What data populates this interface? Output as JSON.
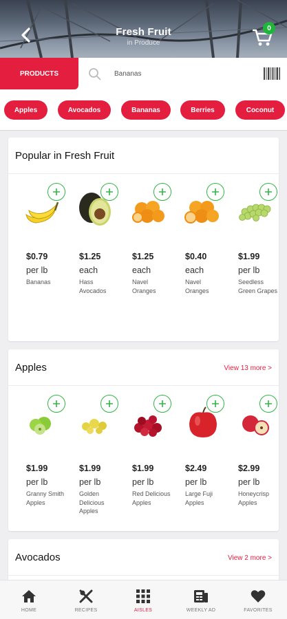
{
  "header": {
    "title": "Fresh Fruit",
    "subtitle": "in Produce",
    "cart_count": "0"
  },
  "search": {
    "products_label": "PRODUCTS",
    "placeholder": "Bananas"
  },
  "chips": [
    "Apples",
    "Avocados",
    "Bananas",
    "Berries",
    "Coconut"
  ],
  "sections": {
    "popular": {
      "title": "Popular in Fresh Fruit",
      "items": [
        {
          "price": "$0.79",
          "unit": "per lb",
          "name": "Bananas",
          "image": "banana"
        },
        {
          "price": "$1.25",
          "unit": "each",
          "name": "Hass Avocados",
          "image": "avocado"
        },
        {
          "price": "$1.25",
          "unit": "each",
          "name": "Navel Oranges",
          "image": "oranges"
        },
        {
          "price": "$0.40",
          "unit": "each",
          "name": "Navel Oranges",
          "image": "oranges"
        },
        {
          "price": "$1.99",
          "unit": "per lb",
          "name": "Seedless Green Grapes",
          "image": "grapes"
        }
      ]
    },
    "apples": {
      "title": "Apples",
      "more": "View 13 more >",
      "items": [
        {
          "price": "$1.99",
          "unit": "per lb",
          "name": "Granny Smith Apples",
          "image": "green-apples"
        },
        {
          "price": "$1.99",
          "unit": "per lb",
          "name": "Golden Delicious Apples",
          "image": "golden-apples"
        },
        {
          "price": "$1.99",
          "unit": "per lb",
          "name": "Red Delicious Apples",
          "image": "red-apples"
        },
        {
          "price": "$2.49",
          "unit": "per lb",
          "name": "Large Fuji Apples",
          "image": "fuji-apple"
        },
        {
          "price": "$2.99",
          "unit": "per lb",
          "name": "Honeycrisp Apples",
          "image": "honeycrisp-apples"
        }
      ]
    },
    "avocados": {
      "title": "Avocados",
      "more": "View 2 more >"
    }
  },
  "nav": [
    {
      "label": "HOME",
      "icon": "home-icon"
    },
    {
      "label": "RECIPES",
      "icon": "recipes-icon"
    },
    {
      "label": "AISLES",
      "icon": "aisles-icon",
      "active": true
    },
    {
      "label": "WEEKLY AD",
      "icon": "weekly-ad-icon"
    },
    {
      "label": "FAVORITES",
      "icon": "favorites-icon"
    }
  ],
  "colors": {
    "accent": "#e41e3f",
    "add_green": "#33b547",
    "badge_green": "#1fb53a"
  }
}
